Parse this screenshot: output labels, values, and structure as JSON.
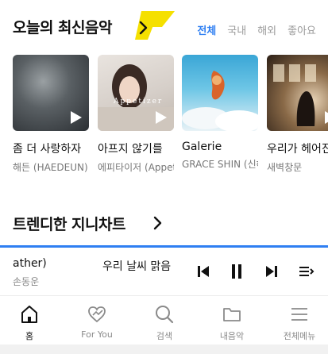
{
  "latest_music": {
    "title": "오늘의 최신음악",
    "accent_color": "#f5e000",
    "filters": [
      {
        "label": "전체",
        "active": true
      },
      {
        "label": "국내",
        "active": false
      },
      {
        "label": "해외",
        "active": false
      },
      {
        "label": "좋아요",
        "active": false
      }
    ],
    "albums": [
      {
        "title": "좀 더 사랑하자",
        "artist": "해든 (HAEDEUN)"
      },
      {
        "title": "아프지 않기를",
        "artist": "에피타이저 (Appetizer)",
        "cover_text": "Appetizer"
      },
      {
        "title": "Galerie",
        "artist": "GRACE SHIN (신혜원)"
      },
      {
        "title": "우리가 헤어진 이유",
        "artist": "새벽창문"
      }
    ]
  },
  "trending_chart": {
    "title": "트렌디한 지니차트"
  },
  "player": {
    "song": "(Feather)",
    "song_visible": "ather)",
    "artist": "손동운",
    "next_song": "우리 날씨 맑음",
    "progress_percent": 100,
    "accent_color": "#2f7ff2"
  },
  "bottom_nav": [
    {
      "label": "홈",
      "icon": "home-icon",
      "active": true
    },
    {
      "label": "For You",
      "icon": "heart-arrow-icon",
      "active": false
    },
    {
      "label": "검색",
      "icon": "search-icon",
      "active": false
    },
    {
      "label": "내음악",
      "icon": "folder-icon",
      "active": false
    },
    {
      "label": "전체메뉴",
      "icon": "menu-icon",
      "active": false
    }
  ]
}
